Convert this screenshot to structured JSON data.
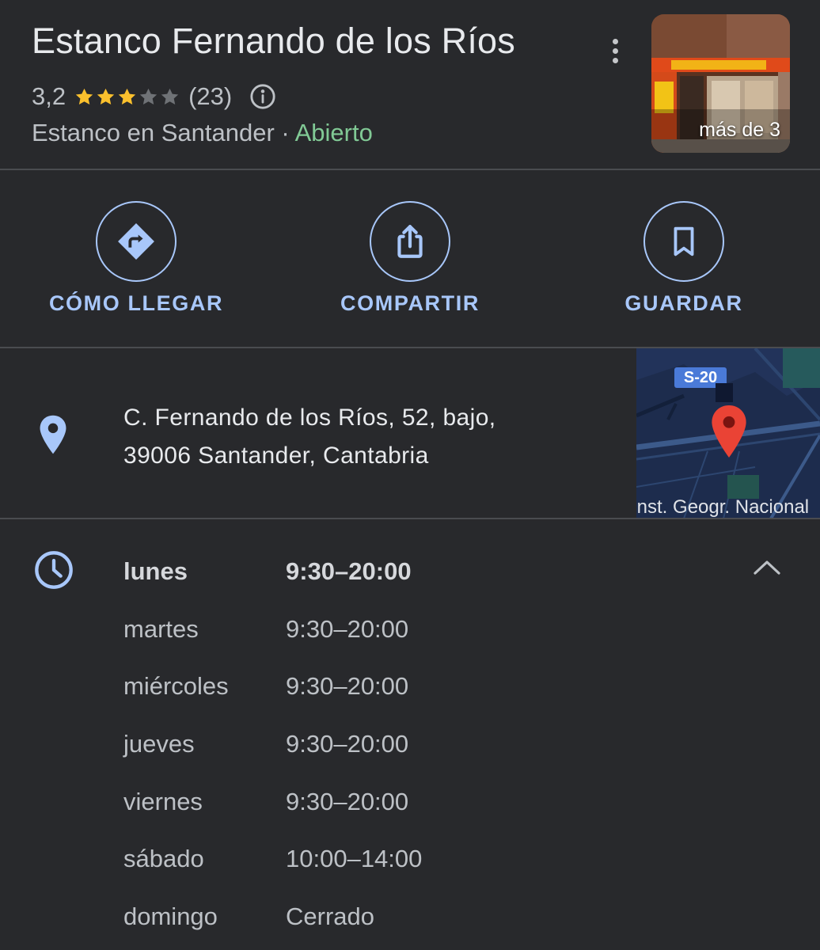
{
  "place": {
    "name": "Estanco Fernando de los Ríos",
    "rating": "3,2",
    "rating_value": 3.2,
    "stars_filled": 3,
    "stars_total": 5,
    "review_count": "(23)",
    "category": "Estanco en Santander",
    "separator": " · ",
    "status": "Abierto",
    "photo_label": "más de 3"
  },
  "actions": [
    {
      "label": "CÓMO LLEGAR",
      "icon": "directions-icon"
    },
    {
      "label": "COMPARTIR",
      "icon": "share-icon"
    },
    {
      "label": "GUARDAR",
      "icon": "bookmark-icon"
    }
  ],
  "address": {
    "line1": "C. Fernando de los Ríos, 52, bajo,",
    "line2": "39006 Santander, Cantabria"
  },
  "map": {
    "road_label": "S-20",
    "caption": "Inst. Geogr. Nacional"
  },
  "hours": [
    {
      "day": "lunes",
      "time": "9:30–20:00",
      "today": true
    },
    {
      "day": "martes",
      "time": "9:30–20:00"
    },
    {
      "day": "miércoles",
      "time": "9:30–20:00"
    },
    {
      "day": "jueves",
      "time": "9:30–20:00"
    },
    {
      "day": "viernes",
      "time": "9:30–20:00"
    },
    {
      "day": "sábado",
      "time": "10:00–14:00"
    },
    {
      "day": "domingo",
      "time": "Cerrado"
    }
  ],
  "colors": {
    "background": "#28292c",
    "accent": "#a8c7fa",
    "open": "#81c995",
    "star": "#fbc02d",
    "star_empty": "#6f7276",
    "map_pin": "#ea4335"
  }
}
